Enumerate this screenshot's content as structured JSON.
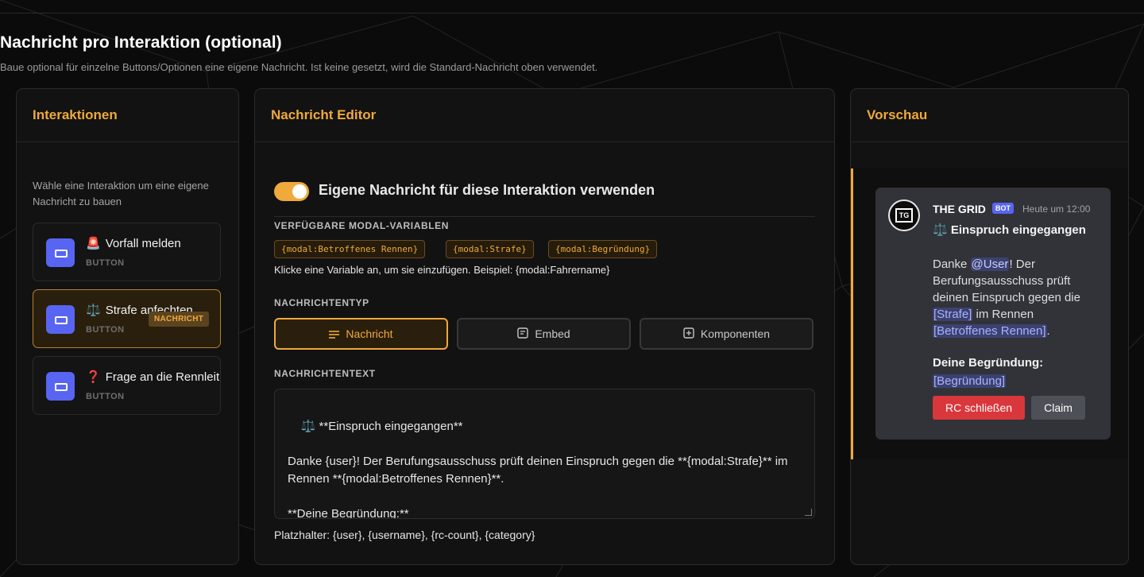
{
  "section": {
    "title": "Nachricht pro Interaktion (optional)",
    "subtitle": "Baue optional für einzelne Buttons/Optionen eine eigene Nachricht. Ist keine gesetzt, wird die Standard-Nachricht oben verwendet."
  },
  "interactions": {
    "title": "Interaktionen",
    "hint": "Wähle eine Interaktion um eine eigene Nachricht zu bauen",
    "items": [
      {
        "emoji": "🚨",
        "label": "Vorfall melden",
        "type": "BUTTON",
        "badge": ""
      },
      {
        "emoji": "⚖️",
        "label": "Strafe anfechten",
        "type": "BUTTON",
        "badge": "NACHRICHT"
      },
      {
        "emoji": "❓",
        "label": "Frage an die Rennleitung",
        "type": "BUTTON",
        "badge": ""
      }
    ]
  },
  "editor": {
    "title": "Nachricht Editor",
    "toggle_label": "Eigene Nachricht für diese Interaktion verwenden",
    "toggle_on": true,
    "vars_label": "VERFÜGBARE MODAL-VARIABLEN",
    "variables": [
      "{modal:Betroffenes Rennen}",
      "{modal:Strafe}",
      "{modal:Begründung}"
    ],
    "vars_hint": "Klicke eine Variable an, um sie einzufügen. Beispiel: {modal:Fahrername}",
    "type_label": "NACHRICHTENTYP",
    "types": [
      {
        "label": "Nachricht",
        "icon": "text-lines-icon",
        "active": true
      },
      {
        "label": "Embed",
        "icon": "embed-icon",
        "active": false
      },
      {
        "label": "Komponenten",
        "icon": "plus-square-icon",
        "active": false
      }
    ],
    "text_label": "NACHRICHTENTEXT",
    "text_value": "⚖️ **Einspruch eingegangen**\n\nDanke {user}! Der Berufungsausschuss prüft deinen Einspruch gegen die **{modal:Strafe}** im Rennen **{modal:Betroffenes Rennen}**.\n\n**Deine Begründung:**\n{modal:Begründung}",
    "placeholders": "Platzhalter: {user}, {username}, {rc-count}, {category}"
  },
  "preview": {
    "title": "Vorschau",
    "bot_name": "THE GRID",
    "bot_badge": "BOT",
    "time": "Heute um 12:00",
    "avatar_text": "TG",
    "msg_title": "⚖️ Einspruch eingegangen",
    "body_p1": "Danke ",
    "mention": "@User",
    "body_p2": "! Der Berufungsausschuss prüft deinen Einspruch gegen die ",
    "ph_strafe": "[Strafe]",
    "body_p3": " im Rennen ",
    "ph_rennen": "[Betroffenes Rennen]",
    "body_p4": ".",
    "reason_label": "Deine Begründung:",
    "ph_reason": "[Begründung]",
    "buttons": [
      "RC schließen",
      "Claim"
    ]
  },
  "colors": {
    "accent": "#f0a93b",
    "blurple": "#5865f2",
    "danger": "#da373c"
  }
}
